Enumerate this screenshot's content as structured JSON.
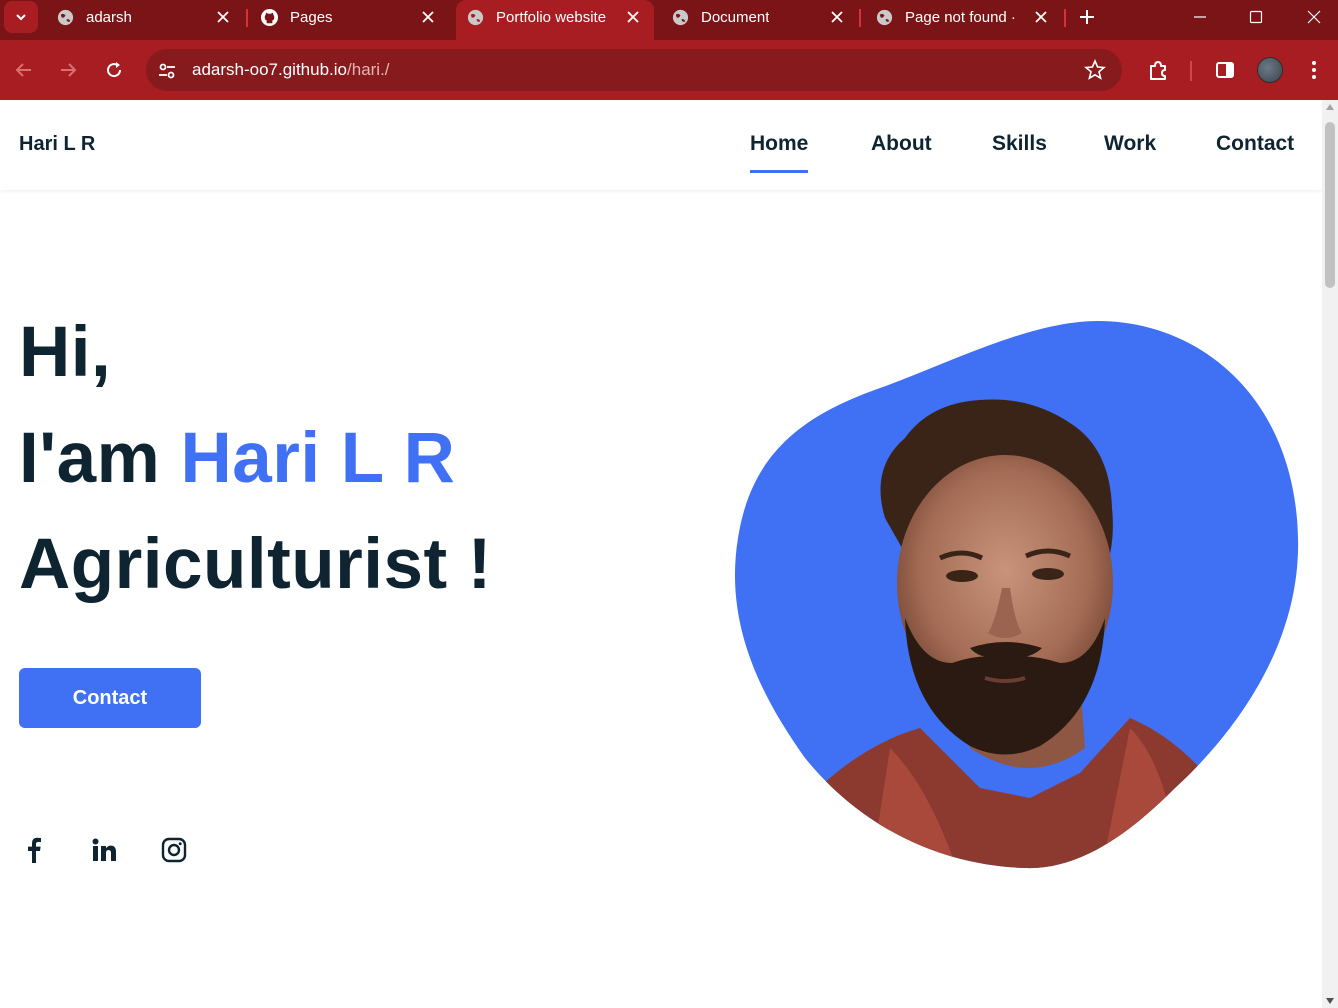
{
  "browser": {
    "tabs": [
      {
        "title": "adarsh",
        "active": false,
        "favicon": "globe-icon"
      },
      {
        "title": "Pages",
        "active": false,
        "favicon": "github-icon"
      },
      {
        "title": "Portfolio website",
        "active": true,
        "favicon": "globe-icon"
      },
      {
        "title": "Document",
        "active": false,
        "favicon": "globe-icon"
      },
      {
        "title": "Page not found ·",
        "active": false,
        "favicon": "globe-icon"
      }
    ],
    "address": {
      "host": "adarsh-oo7.github.io",
      "path": "/hari./"
    },
    "colors": {
      "tabstrip": "#7a1416",
      "toolbar": "#a81d22",
      "omnibox": "#861a1d"
    }
  },
  "site": {
    "logo": "Hari L R",
    "nav": [
      {
        "label": "Home",
        "active": true
      },
      {
        "label": "About",
        "active": false
      },
      {
        "label": "Skills",
        "active": false
      },
      {
        "label": "Work",
        "active": false
      },
      {
        "label": "Contact",
        "active": false
      }
    ],
    "hero": {
      "line1": "Hi,",
      "line2_prefix": "I'am",
      "name": "Hari L R",
      "line3": "Agriculturist !",
      "cta": "Contact"
    },
    "social": [
      "facebook-icon",
      "linkedin-icon",
      "instagram-icon"
    ],
    "colors": {
      "accent": "#4070f4",
      "text": "#0e2431"
    }
  }
}
